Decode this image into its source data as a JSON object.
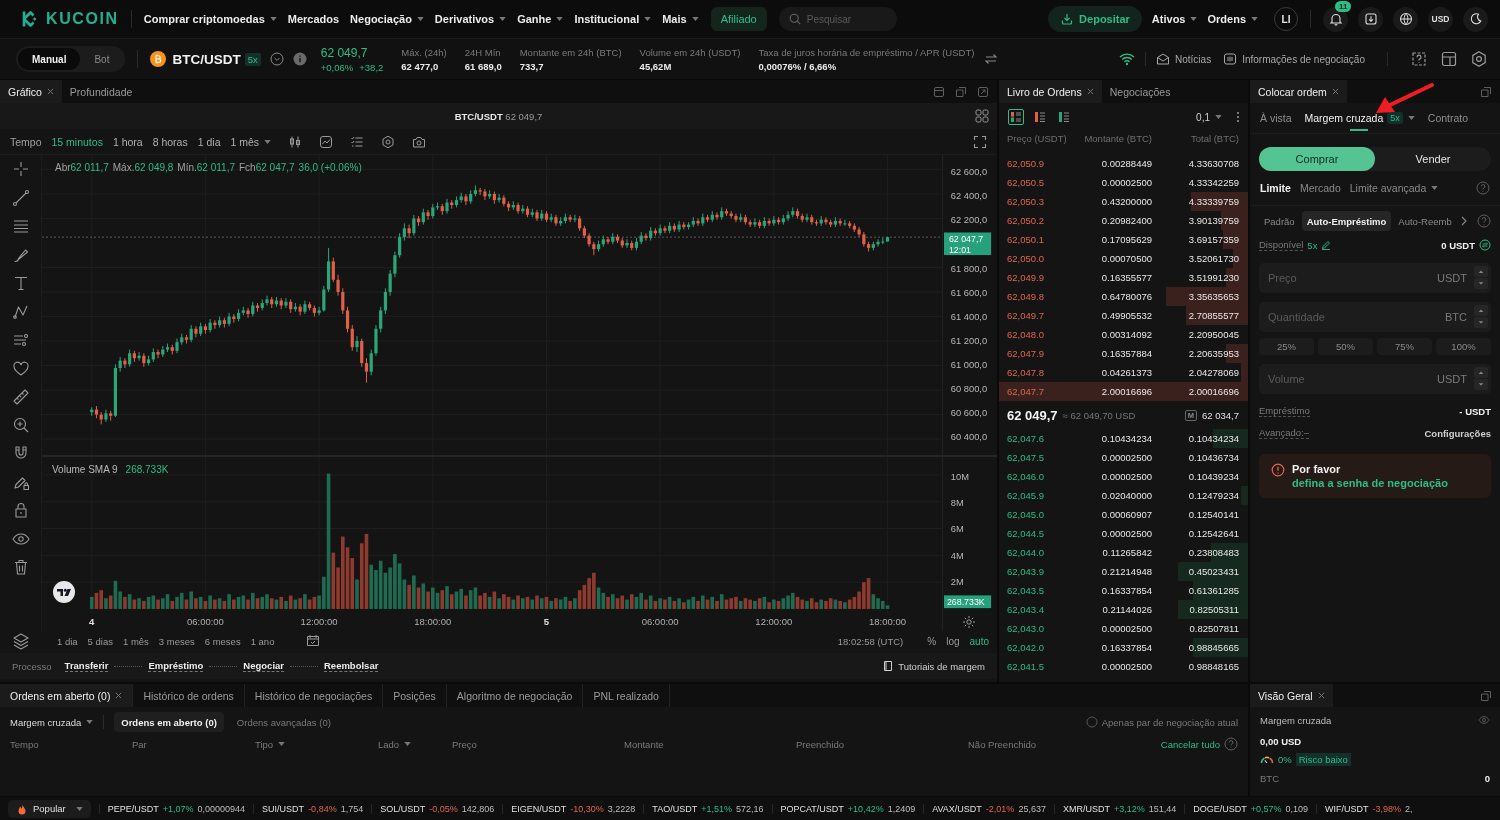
{
  "header": {
    "logo": "KUCOIN",
    "nav": [
      {
        "label": "Comprar criptomoedas",
        "dropdown": true
      },
      {
        "label": "Mercados",
        "dropdown": false
      },
      {
        "label": "Negociação",
        "dropdown": true
      },
      {
        "label": "Derivativos",
        "dropdown": true
      },
      {
        "label": "Ganhe",
        "dropdown": true
      },
      {
        "label": "Institucional",
        "dropdown": true
      },
      {
        "label": "Mais",
        "dropdown": true
      }
    ],
    "affiliate": "Afiliado",
    "search": {
      "placeholder": "Pesquisar"
    },
    "deposit": "Depositar",
    "menus": [
      {
        "label": "Ativos",
        "dropdown": true
      },
      {
        "label": "Ordens",
        "dropdown": true
      }
    ],
    "avatar": "LI",
    "notification_count": "11",
    "currency": "USD"
  },
  "market_bar": {
    "modes": [
      {
        "label": "Manual",
        "selected": true
      },
      {
        "label": "Bot",
        "selected": false
      }
    ],
    "pair": "BTC/USDT",
    "leverage": "5x",
    "price": "62 049,7",
    "change_percent": "+0,06%",
    "change": "+38,2",
    "stats": [
      {
        "label": "Máx. (24h)",
        "value": "62 477,0"
      },
      {
        "label": "24H Mín",
        "value": "61 689,0"
      },
      {
        "label": "Montante em 24h (BTC)",
        "value": "733,7"
      },
      {
        "label": "Volume em 24h (USDT)",
        "value": "45,62M"
      },
      {
        "label": "Taxa de juros horária de empréstimo / APR (USDT)",
        "value": "0,00076% / 6,66%"
      }
    ],
    "links": [
      {
        "kind": "news",
        "label": "Notícias"
      },
      {
        "kind": "info",
        "label": "Informações de negociação"
      }
    ]
  },
  "chart": {
    "tabs": [
      {
        "label": "Gráfico",
        "selected": true,
        "closable": true
      },
      {
        "label": "Profundidade",
        "selected": false,
        "closable": false
      }
    ],
    "pair": "BTC/USDT",
    "price": "62 049,7",
    "time_label": "Tempo",
    "intervals": [
      {
        "label": "15 minutos",
        "selected": true,
        "dropdown": false
      },
      {
        "label": "1 hora",
        "selected": false,
        "dropdown": false
      },
      {
        "label": "8 horas",
        "selected": false,
        "dropdown": false
      },
      {
        "label": "1 dia",
        "selected": false,
        "dropdown": false
      },
      {
        "label": "1 mês",
        "selected": false,
        "dropdown": true
      }
    ],
    "legend": [
      {
        "label": "Abr",
        "value": "62 011,7"
      },
      {
        "label": "Máx.",
        "value": "62 049,8"
      },
      {
        "label": "Mín.",
        "value": "62 011,7"
      },
      {
        "label": "Fch",
        "value": "62 047,7"
      }
    ],
    "legend_change": "36,0 (+0.06%)",
    "chart_data": {
      "type": "candlestick",
      "grid": true,
      "categories": [
        null,
        null,
        null,
        null,
        null,
        null,
        null,
        null,
        null,
        null,
        null,
        null,
        null,
        null,
        null,
        null,
        null,
        null,
        null,
        null,
        null,
        null,
        null,
        null,
        null,
        null,
        null,
        null,
        null,
        null,
        null,
        null,
        null,
        null,
        null,
        null,
        null,
        null,
        null,
        null,
        null,
        null,
        null,
        null,
        null,
        null,
        null,
        null,
        null,
        null,
        null,
        null,
        null,
        null,
        null,
        null,
        null,
        null,
        null,
        null,
        null,
        null,
        null,
        null,
        null,
        null,
        null,
        null,
        null,
        null,
        null,
        null,
        null,
        null,
        null,
        null,
        null,
        null,
        null,
        null,
        null,
        null,
        null,
        null,
        null,
        null,
        null,
        null,
        null,
        null,
        null,
        null,
        null,
        null,
        null,
        null,
        null,
        null,
        null,
        null,
        null,
        null,
        null,
        null,
        null,
        null,
        null,
        null,
        null,
        null,
        null,
        null,
        null,
        null,
        null,
        null,
        null,
        null,
        null,
        null,
        null,
        null,
        null,
        null,
        null,
        null,
        null,
        null,
        null,
        null,
        null,
        null,
        null,
        null,
        null,
        null,
        null,
        null,
        null,
        null,
        null,
        null,
        null,
        null,
        null,
        null,
        null,
        null,
        null,
        null,
        null,
        null,
        null,
        null,
        null,
        null,
        null,
        null,
        null,
        null,
        null,
        null,
        null,
        null,
        null,
        null,
        null,
        null,
        null,
        null,
        null,
        null,
        null,
        null,
        null,
        null,
        null,
        null,
        null,
        null,
        null,
        null,
        null,
        null,
        null,
        null,
        null,
        null,
        null,
        null
      ],
      "ohlc": [
        null,
        null,
        null,
        null,
        null,
        null,
        null,
        null,
        null,
        null,
        [
          60620,
          60660,
          60590,
          60640
        ],
        [
          60640,
          60670,
          60570,
          60600
        ],
        [
          60600,
          60620,
          60520,
          60560
        ],
        [
          60560,
          60640,
          60540,
          60610
        ],
        [
          60610,
          60630,
          60550,
          60590
        ],
        [
          60590,
          61010,
          60580,
          60980
        ],
        [
          60980,
          61070,
          60950,
          61040
        ],
        [
          61040,
          61060,
          60980,
          61010
        ],
        [
          61010,
          61130,
          60990,
          61100
        ],
        [
          61100,
          61120,
          61030,
          61060
        ],
        [
          61060,
          61110,
          61040,
          61080
        ],
        [
          61080,
          61100,
          60990,
          61020
        ],
        [
          61020,
          61080,
          61000,
          61050
        ],
        [
          61050,
          61140,
          61030,
          61110
        ],
        [
          61110,
          61130,
          61060,
          61090
        ],
        [
          61090,
          61160,
          61070,
          61130
        ],
        [
          61130,
          61180,
          61110,
          61150
        ],
        [
          61150,
          61170,
          61090,
          61120
        ],
        [
          61120,
          61220,
          61100,
          61190
        ],
        [
          61190,
          61260,
          61170,
          61230
        ],
        [
          61230,
          61250,
          61180,
          61210
        ],
        [
          61210,
          61330,
          61190,
          61300
        ],
        [
          61300,
          61320,
          61230,
          61260
        ],
        [
          61260,
          61350,
          61240,
          61320
        ],
        [
          61320,
          61340,
          61260,
          61290
        ],
        [
          61290,
          61380,
          61270,
          61350
        ],
        [
          61350,
          61370,
          61300,
          61330
        ],
        [
          61330,
          61400,
          61310,
          61370
        ],
        [
          61370,
          61390,
          61310,
          61340
        ],
        [
          61340,
          61430,
          61320,
          61400
        ],
        [
          61400,
          61420,
          61350,
          61380
        ],
        [
          61380,
          61460,
          61360,
          61430
        ],
        [
          61430,
          61480,
          61410,
          61450
        ],
        [
          61450,
          61470,
          61390,
          61420
        ],
        [
          61420,
          61520,
          61400,
          61490
        ],
        [
          61490,
          61510,
          61440,
          61470
        ],
        [
          61470,
          61540,
          61450,
          61510
        ],
        [
          61510,
          61570,
          61490,
          61540
        ],
        [
          61540,
          61560,
          61470,
          61500
        ],
        [
          61500,
          61560,
          61480,
          61530
        ],
        [
          61530,
          61550,
          61460,
          61490
        ],
        [
          61490,
          61550,
          61470,
          61520
        ],
        [
          61520,
          61540,
          61430,
          61460
        ],
        [
          61460,
          61510,
          61440,
          61480
        ],
        [
          61480,
          61500,
          61410,
          61440
        ],
        [
          61440,
          61530,
          61420,
          61500
        ],
        [
          61500,
          61520,
          61450,
          61470
        ],
        [
          61470,
          61490,
          61400,
          61430
        ],
        [
          61430,
          61480,
          61410,
          61450
        ],
        [
          61450,
          61650,
          61440,
          61620
        ],
        [
          61620,
          61960,
          61600,
          61850
        ],
        [
          61850,
          61880,
          61680,
          61700
        ],
        [
          61700,
          61740,
          61570,
          61600
        ],
        [
          61600,
          61630,
          61420,
          61450
        ],
        [
          61450,
          61480,
          61270,
          61300
        ],
        [
          61300,
          61330,
          61120,
          61150
        ],
        [
          61150,
          61240,
          61110,
          61200
        ],
        [
          61200,
          61220,
          60990,
          61020
        ],
        [
          61020,
          61060,
          60860,
          60950
        ],
        [
          60950,
          61130,
          60920,
          61100
        ],
        [
          61100,
          61330,
          61080,
          61300
        ],
        [
          61300,
          61480,
          61270,
          61450
        ],
        [
          61450,
          61630,
          61420,
          61600
        ],
        [
          61600,
          61780,
          61570,
          61750
        ],
        [
          61750,
          61930,
          61720,
          61900
        ],
        [
          61900,
          62080,
          61880,
          62050
        ],
        [
          62050,
          62160,
          62020,
          62120
        ],
        [
          62120,
          62150,
          62040,
          62080
        ],
        [
          62080,
          62230,
          62060,
          62200
        ],
        [
          62200,
          62220,
          62140,
          62170
        ],
        [
          62170,
          62280,
          62150,
          62250
        ],
        [
          62250,
          62270,
          62190,
          62220
        ],
        [
          62220,
          62320,
          62200,
          62290
        ],
        [
          62290,
          62330,
          62270,
          62300
        ],
        [
          62300,
          62320,
          62230,
          62260
        ],
        [
          62260,
          62360,
          62240,
          62330
        ],
        [
          62330,
          62350,
          62280,
          62310
        ],
        [
          62310,
          62380,
          62290,
          62350
        ],
        [
          62350,
          62410,
          62330,
          62380
        ],
        [
          62380,
          62400,
          62310,
          62340
        ],
        [
          62340,
          62430,
          62320,
          62400
        ],
        [
          62400,
          62470,
          62380,
          62430
        ],
        [
          62430,
          62450,
          62390,
          62420
        ],
        [
          62420,
          62440,
          62350,
          62380
        ],
        [
          62380,
          62430,
          62360,
          62400
        ],
        [
          62400,
          62420,
          62320,
          62350
        ],
        [
          62350,
          62400,
          62330,
          62370
        ],
        [
          62370,
          62390,
          62300,
          62320
        ],
        [
          62320,
          62340,
          62260,
          62290
        ],
        [
          62290,
          62340,
          62270,
          62310
        ],
        [
          62310,
          62330,
          62240,
          62260
        ],
        [
          62260,
          62310,
          62240,
          62280
        ],
        [
          62280,
          62300,
          62210,
          62230
        ],
        [
          62230,
          62280,
          62210,
          62250
        ],
        [
          62250,
          62270,
          62180,
          62200
        ],
        [
          62200,
          62270,
          62180,
          62240
        ],
        [
          62240,
          62260,
          62170,
          62190
        ],
        [
          62190,
          62240,
          62170,
          62210
        ],
        [
          62210,
          62230,
          62140,
          62160
        ],
        [
          62160,
          62210,
          62140,
          62180
        ],
        [
          62180,
          62240,
          62160,
          62210
        ],
        [
          62210,
          62230,
          62170,
          62190
        ],
        [
          62190,
          62230,
          62170,
          62200
        ],
        [
          62200,
          62220,
          62100,
          62120
        ],
        [
          62120,
          62140,
          62040,
          62060
        ],
        [
          62060,
          62080,
          61970,
          61990
        ],
        [
          61990,
          62010,
          61900,
          61950
        ],
        [
          61950,
          62020,
          61930,
          61990
        ],
        [
          61990,
          62060,
          61970,
          62030
        ],
        [
          62030,
          62050,
          61990,
          62010
        ],
        [
          62010,
          62080,
          61990,
          62050
        ],
        [
          62050,
          62070,
          62000,
          62020
        ],
        [
          62020,
          62040,
          61960,
          61980
        ],
        [
          61980,
          62030,
          61960,
          62000
        ],
        [
          62000,
          62020,
          61940,
          61960
        ],
        [
          61960,
          62040,
          61940,
          62010
        ],
        [
          62010,
          62090,
          61990,
          62060
        ],
        [
          62060,
          62080,
          62020,
          62040
        ],
        [
          62040,
          62130,
          62020,
          62100
        ],
        [
          62100,
          62120,
          62060,
          62080
        ],
        [
          62080,
          62150,
          62060,
          62120
        ],
        [
          62120,
          62140,
          62080,
          62100
        ],
        [
          62100,
          62170,
          62080,
          62140
        ],
        [
          62140,
          62160,
          62090,
          62110
        ],
        [
          62110,
          62180,
          62090,
          62150
        ],
        [
          62150,
          62170,
          62110,
          62130
        ],
        [
          62130,
          62170,
          62110,
          62150
        ],
        [
          62150,
          62210,
          62130,
          62180
        ],
        [
          62180,
          62200,
          62140,
          62160
        ],
        [
          62160,
          62240,
          62140,
          62210
        ],
        [
          62210,
          62230,
          62170,
          62190
        ],
        [
          62190,
          62260,
          62170,
          62230
        ],
        [
          62230,
          62250,
          62190,
          62210
        ],
        [
          62210,
          62290,
          62190,
          62260
        ],
        [
          62260,
          62280,
          62220,
          62240
        ],
        [
          62240,
          62260,
          62200,
          62220
        ],
        [
          62220,
          62240,
          62170,
          62190
        ],
        [
          62190,
          62240,
          62170,
          62210
        ],
        [
          62210,
          62230,
          62150,
          62170
        ],
        [
          62170,
          62190,
          62130,
          62150
        ],
        [
          62150,
          62200,
          62130,
          62170
        ],
        [
          62170,
          62190,
          62120,
          62140
        ],
        [
          62140,
          62210,
          62120,
          62180
        ],
        [
          62180,
          62200,
          62140,
          62160
        ],
        [
          62160,
          62220,
          62140,
          62190
        ],
        [
          62190,
          62210,
          62150,
          62170
        ],
        [
          62170,
          62230,
          62150,
          62200
        ],
        [
          62200,
          62260,
          62180,
          62230
        ],
        [
          62230,
          62290,
          62210,
          62260
        ],
        [
          62260,
          62280,
          62200,
          62220
        ],
        [
          62220,
          62240,
          62170,
          62190
        ],
        [
          62190,
          62240,
          62170,
          62210
        ],
        [
          62210,
          62230,
          62150,
          62170
        ],
        [
          62170,
          62190,
          62140,
          62160
        ],
        [
          62160,
          62220,
          62140,
          62190
        ],
        [
          62190,
          62210,
          62150,
          62170
        ],
        [
          62170,
          62190,
          62130,
          62150
        ],
        [
          62150,
          62210,
          62130,
          62180
        ],
        [
          62180,
          62200,
          62140,
          62160
        ],
        [
          62160,
          62190,
          62140,
          62160
        ],
        [
          62160,
          62180,
          62120,
          62140
        ],
        [
          62140,
          62160,
          62090,
          62110
        ],
        [
          62110,
          62130,
          62050,
          62070
        ],
        [
          62070,
          62090,
          61970,
          61990
        ],
        [
          61990,
          62010,
          61930,
          61960
        ],
        [
          61960,
          62010,
          61940,
          61990
        ],
        [
          61990,
          62030,
          61970,
          62010
        ],
        [
          62010,
          62040,
          61990,
          62011.7
        ],
        [
          62011.7,
          62049.8,
          62011.7,
          62047.7
        ],
        null,
        null,
        null,
        null,
        null,
        null,
        null,
        null,
        null,
        null,
        null
      ],
      "ylim": [
        60270,
        62718
      ],
      "yticks": [
        {
          "value": 62600,
          "label": "62 600,0"
        },
        {
          "value": 62400,
          "label": "62 400,0"
        },
        {
          "value": 62200,
          "label": "62 200,0"
        },
        {
          "value": 61800,
          "label": "61 800,0"
        },
        {
          "value": 61600,
          "label": "61 600,0"
        },
        {
          "value": 61400,
          "label": "61 400,0"
        },
        {
          "value": 61200,
          "label": "61 200,0"
        },
        {
          "value": 61000,
          "label": "61 000,0"
        },
        {
          "value": 60800,
          "label": "60 800,0"
        },
        {
          "value": 60600,
          "label": "60 600,0"
        },
        {
          "value": 60400,
          "label": "60 400,0"
        }
      ],
      "ref_lines": [
        {
          "axis": "y",
          "value": 62047.7
        }
      ],
      "annotations": [
        "62 047,7",
        "12:01"
      ]
    },
    "volume": {
      "legend_label": "Volume SMA 9",
      "legend_value": "268.733K",
      "chart_data": {
        "type": "bar",
        "grid": true,
        "categories": [
          null,
          null,
          null,
          null,
          null,
          null,
          null,
          null,
          null,
          null,
          "4",
          null,
          null,
          null,
          null,
          null,
          null,
          null,
          null,
          null,
          null,
          null,
          null,
          null,
          null,
          null,
          null,
          null,
          null,
          null,
          null,
          null,
          null,
          null,
          "06:00:00",
          null,
          null,
          null,
          null,
          null,
          null,
          null,
          null,
          null,
          null,
          null,
          null,
          null,
          null,
          null,
          null,
          null,
          null,
          null,
          null,
          null,
          null,
          null,
          "12:00:00",
          null,
          null,
          null,
          null,
          null,
          null,
          null,
          null,
          null,
          null,
          null,
          null,
          null,
          null,
          null,
          null,
          null,
          null,
          null,
          null,
          null,
          null,
          null,
          "18:00:00",
          null,
          null,
          null,
          null,
          null,
          null,
          null,
          null,
          null,
          null,
          null,
          null,
          null,
          null,
          null,
          null,
          null,
          null,
          null,
          null,
          null,
          null,
          null,
          "5",
          null,
          null,
          null,
          null,
          null,
          null,
          null,
          null,
          null,
          null,
          null,
          null,
          null,
          null,
          null,
          null,
          null,
          null,
          null,
          null,
          null,
          null,
          null,
          "06:00:00",
          null,
          null,
          null,
          null,
          null,
          null,
          null,
          null,
          null,
          null,
          null,
          null,
          null,
          null,
          null,
          null,
          null,
          null,
          null,
          null,
          null,
          null,
          null,
          "12:00:00",
          null,
          null,
          null,
          null,
          null,
          null,
          null,
          null,
          null,
          null,
          null,
          null,
          null,
          null,
          null,
          null,
          null,
          null,
          null,
          null,
          null,
          null,
          null,
          "18:00:00",
          null,
          null,
          null,
          null,
          null,
          null,
          null,
          null,
          null,
          null,
          null
        ],
        "values": [
          null,
          null,
          null,
          null,
          null,
          null,
          null,
          null,
          null,
          null,
          900000,
          1200000,
          1400000,
          800000,
          1000000,
          2100000,
          1300000,
          900000,
          1100000,
          700000,
          800000,
          600000,
          900000,
          1000000,
          700000,
          800000,
          1100000,
          600000,
          900000,
          1200000,
          700000,
          1300000,
          800000,
          900000,
          600000,
          1000000,
          700000,
          800000,
          600000,
          1100000,
          700000,
          900000,
          1000000,
          700000,
          1200000,
          800000,
          900000,
          1100000,
          800000,
          700000,
          900000,
          600000,
          1000000,
          700000,
          800000,
          1100000,
          700000,
          900000,
          1000000,
          2400000,
          10100000,
          4200000,
          3100000,
          5400000,
          4600000,
          3800000,
          2200000,
          4900000,
          5600000,
          3300000,
          2900000,
          3600000,
          2700000,
          3100000,
          4100000,
          3400000,
          2200000,
          1800000,
          2500000,
          1600000,
          1900000,
          1300000,
          1600000,
          1200000,
          1400000,
          1700000,
          1100000,
          1300000,
          1500000,
          1000000,
          1400000,
          1600000,
          1000000,
          1200000,
          900000,
          1300000,
          800000,
          1100000,
          900000,
          700000,
          1000000,
          800000,
          900000,
          700000,
          1000000,
          800000,
          900000,
          600000,
          800000,
          700000,
          900000,
          600000,
          800000,
          1400000,
          1800000,
          2300000,
          2700000,
          1600000,
          1200000,
          900000,
          1100000,
          800000,
          1000000,
          700000,
          1100000,
          900000,
          1200000,
          700000,
          1000000,
          600000,
          800000,
          700000,
          900000,
          600000,
          800000,
          500000,
          700000,
          900000,
          600000,
          1000000,
          700000,
          900000,
          600000,
          1100000,
          700000,
          800000,
          900000,
          600000,
          800000,
          700000,
          600000,
          800000,
          900000,
          500000,
          700000,
          600000,
          800000,
          1000000,
          1200000,
          900000,
          700000,
          600000,
          800000,
          500000,
          700000,
          600000,
          800000,
          700000,
          600000,
          500000,
          700000,
          900000,
          1300000,
          2000000,
          2300000,
          1100000,
          800000,
          600000,
          270000,
          null,
          null,
          null,
          null,
          null,
          null,
          null,
          null,
          null,
          null,
          null
        ],
        "ylim": [
          -1645000,
          11340000
        ],
        "yticks": [
          {
            "value": 10000000,
            "label": "10M"
          },
          {
            "value": 8000000,
            "label": "8M"
          },
          {
            "value": 6000000,
            "label": "6M"
          },
          {
            "value": 4000000,
            "label": "4M"
          },
          {
            "value": 2000000,
            "label": "2M"
          }
        ],
        "annotations": [
          "268.733K"
        ]
      }
    },
    "ranges": [
      "1 dia",
      "5 dias",
      "1 mês",
      "3 meses",
      "6 meses",
      "1 ano"
    ],
    "clock": "18:02:58 (UTC)",
    "scale_options": [
      {
        "label": "%",
        "selected": false
      },
      {
        "label": "log",
        "selected": false
      },
      {
        "label": "auto",
        "selected": true
      }
    ],
    "process": {
      "label": "Processo",
      "steps": [
        "Transferir",
        "Empréstimo",
        "Negociar",
        "Reembolsar"
      ],
      "tutorial": "Tutoriais de margem"
    }
  },
  "order_book": {
    "tabs": [
      {
        "label": "Livro de Ordens",
        "selected": true,
        "closable": true
      },
      {
        "label": "Negociações",
        "selected": false,
        "closable": false
      }
    ],
    "view_modes": [
      {
        "kind": "both",
        "selected": true
      },
      {
        "kind": "asks",
        "selected": false
      },
      {
        "kind": "bids",
        "selected": false
      }
    ],
    "precision": "0,1",
    "columns": [
      "Preço (USDT)",
      "Montante (BTC)",
      "Total (BTC)"
    ],
    "asks": [
      {
        "price": "62,050.9",
        "amount": "0.00288449",
        "total": "4.33630708"
      },
      {
        "price": "62,050.5",
        "amount": "0.00002500",
        "total": "4.33342259"
      },
      {
        "price": "62,050.3",
        "amount": "0.43200000",
        "total": "4.33339759",
        "level": 0.23
      },
      {
        "price": "62,050.2",
        "amount": "0.20982400",
        "total": "3.90139759",
        "level": 0.11
      },
      {
        "price": "62,050.1",
        "amount": "0.17095629",
        "total": "3.69157359",
        "level": 0.1
      },
      {
        "price": "62,050.0",
        "amount": "0.00070500",
        "total": "3.52061730",
        "level": 0.06
      },
      {
        "price": "62,049.9",
        "amount": "0.16355577",
        "total": "3.51991230",
        "level": 0.09
      },
      {
        "price": "62,049.8",
        "amount": "0.64780076",
        "total": "3.35635653",
        "level": 0.33
      },
      {
        "price": "62,049.7",
        "amount": "0.49905532",
        "total": "2.70855577",
        "level": 0.25
      },
      {
        "price": "62,048.0",
        "amount": "0.00314092",
        "total": "2.20950045"
      },
      {
        "price": "62,047.9",
        "amount": "0.16357884",
        "total": "2.20635953",
        "level": 0.09
      },
      {
        "price": "62,047.8",
        "amount": "0.04261373",
        "total": "2.04278069",
        "level": 0.03
      },
      {
        "price": "62,047.7",
        "amount": "2.00016696",
        "total": "2.00016696",
        "level": 1
      }
    ],
    "last_price": "62 049,7",
    "last_price_usd": "≈ 62 049,70 USD",
    "mark_symbol": "M",
    "mark_price": "62 034,7",
    "bids": [
      {
        "price": "62,047.6",
        "amount": "0.10434234",
        "total": "0.10434234",
        "level": 0.14
      },
      {
        "price": "62,047.5",
        "amount": "0.00002500",
        "total": "0.10436734"
      },
      {
        "price": "62,046.0",
        "amount": "0.00002500",
        "total": "0.10439234"
      },
      {
        "price": "62,045.9",
        "amount": "0.02040000",
        "total": "0.12479234",
        "level": 0.03
      },
      {
        "price": "62,045.0",
        "amount": "0.00060907",
        "total": "0.12540141"
      },
      {
        "price": "62,044.5",
        "amount": "0.00002500",
        "total": "0.12542641"
      },
      {
        "price": "62,044.0",
        "amount": "0.11265842",
        "total": "0.23808483",
        "level": 0.15
      },
      {
        "price": "62,043.9",
        "amount": "0.21214948",
        "total": "0.45023431",
        "level": 0.28
      },
      {
        "price": "62,043.5",
        "amount": "0.16337854",
        "total": "0.61361285",
        "level": 0.22
      },
      {
        "price": "62,043.4",
        "amount": "0.21144026",
        "total": "0.82505311",
        "level": 0.28
      },
      {
        "price": "62,043.0",
        "amount": "0.00002500",
        "total": "0.82507811"
      },
      {
        "price": "62,042.0",
        "amount": "0.16337854",
        "total": "0.98845665",
        "level": 0.22
      },
      {
        "price": "62,041.5",
        "amount": "0.00002500",
        "total": "0.98848165"
      }
    ]
  },
  "order_form": {
    "tabs": [
      {
        "label": "Colocar ordem",
        "selected": true,
        "closable": true
      }
    ],
    "markets": [
      {
        "label": "À vista",
        "selected": false,
        "dropdown": false
      },
      {
        "label": "Margem cruzada",
        "selected": true,
        "badge": "5x",
        "dropdown": true
      },
      {
        "label": "Contrato",
        "selected": false,
        "dropdown": false
      }
    ],
    "sides": [
      {
        "label": "Comprar",
        "selected": true
      },
      {
        "label": "Vender",
        "selected": false
      }
    ],
    "order_types": [
      {
        "label": "Limite",
        "selected": true,
        "dropdown": false
      },
      {
        "label": "Mercado",
        "selected": false,
        "dropdown": false
      },
      {
        "label": "Limite avançada",
        "selected": false,
        "dropdown": true
      }
    ],
    "modes": [
      {
        "label": "Padrão",
        "selected": false
      },
      {
        "label": "Auto-Empréstimo",
        "selected": true
      },
      {
        "label": "Auto-Reemb",
        "selected": false
      }
    ],
    "available": {
      "label": "Disponível",
      "leverage": "5x",
      "value": "0 USDT"
    },
    "fields": [
      {
        "kind": "input",
        "placeholder": "Preço",
        "unit": "USDT"
      },
      {
        "kind": "input",
        "placeholder": "Quantidade",
        "unit": "BTC"
      },
      {
        "kind": "percent",
        "options": [
          "25%",
          "50%",
          "75%",
          "100%"
        ]
      },
      {
        "kind": "input",
        "placeholder": "Volume",
        "unit": "USDT"
      }
    ],
    "loan": {
      "label": "Empréstimo",
      "value": "- USDT"
    },
    "advanced": {
      "label": "Avançado:–",
      "value": "Configurações"
    },
    "alert": {
      "text": "Por favor",
      "link": "defina a senha de negociação"
    }
  },
  "orders": {
    "tabs": [
      {
        "label": "Ordens em aberto (0)",
        "selected": true,
        "closable": true
      },
      {
        "label": "Histórico de ordens",
        "selected": false,
        "closable": false
      },
      {
        "label": "Histórico de negociações",
        "selected": false,
        "closable": false
      },
      {
        "label": "Posições",
        "selected": false,
        "closable": false
      },
      {
        "label": "Algoritmo de negociação",
        "selected": false,
        "closable": false
      },
      {
        "label": "PNL realizado",
        "selected": false,
        "closable": false
      }
    ],
    "account_filter": "Margem cruzada",
    "filters": [
      {
        "label": "Ordens em aberto (0)",
        "selected": true
      },
      {
        "label": "Ordens avançadas (0)",
        "selected": false
      }
    ],
    "current_pair_only": {
      "label": "Apenas par de negociação atual",
      "checked": false
    },
    "columns": [
      {
        "label": "Tempo",
        "sortable": false
      },
      {
        "label": "Par",
        "sortable": false
      },
      {
        "label": "Tipo",
        "sortable": true
      },
      {
        "label": "Lado",
        "sortable": true
      },
      {
        "label": "Preço",
        "sortable": false
      },
      {
        "label": "Montante",
        "sortable": false
      },
      {
        "label": "Preenchido",
        "sortable": false
      },
      {
        "label": "Não Preenchido",
        "sortable": false
      }
    ],
    "cancel_all": "Cancelar tudo"
  },
  "overview": {
    "tabs": [
      {
        "label": "Visão Geral",
        "selected": true,
        "closable": true
      }
    ],
    "account": "Margem cruzada",
    "balance": "0,00 USD",
    "risk_percent": "0%",
    "risk_label": "Risco baixo",
    "assets": [
      {
        "label": "BTC",
        "value": "0"
      }
    ]
  },
  "ticker": {
    "category": "Popular",
    "items": [
      {
        "pair": "PEPE/USDT",
        "change": "+1,07%",
        "rising": true,
        "price": "0,00000944"
      },
      {
        "pair": "SUI/USDT",
        "change": "-0,84%",
        "rising": false,
        "price": "1,754"
      },
      {
        "pair": "SOL/USDT",
        "change": "-0,05%",
        "rising": false,
        "price": "142,806"
      },
      {
        "pair": "EIGEN/USDT",
        "change": "-10,30%",
        "rising": false,
        "price": "3,2228"
      },
      {
        "pair": "TAO/USDT",
        "change": "+1,51%",
        "rising": true,
        "price": "572,16"
      },
      {
        "pair": "POPCAT/USDT",
        "change": "+10,42%",
        "rising": true,
        "price": "1,2409"
      },
      {
        "pair": "AVAX/USDT",
        "change": "-2,01%",
        "rising": false,
        "price": "25,637"
      },
      {
        "pair": "XMR/USDT",
        "change": "+3,12%",
        "rising": true,
        "price": "151,44"
      },
      {
        "pair": "DOGE/USDT",
        "change": "+0,57%",
        "rising": true,
        "price": "0,109"
      },
      {
        "pair": "WIF/USDT",
        "change": "-3,98%",
        "rising": false,
        "price": "2,"
      }
    ]
  },
  "annotation": {
    "kind": "arrow"
  }
}
